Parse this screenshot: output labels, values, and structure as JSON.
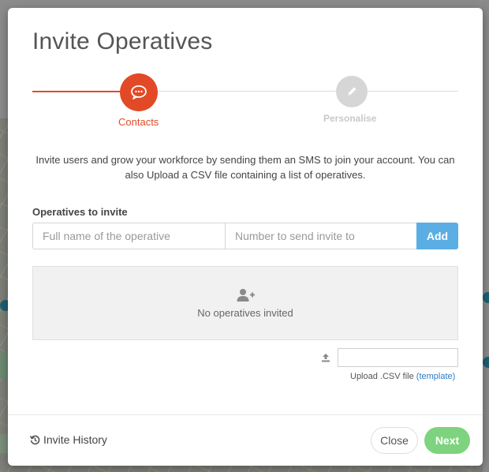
{
  "modal": {
    "title": "Invite Operatives",
    "steps": [
      {
        "label": "Contacts",
        "state": "active"
      },
      {
        "label": "Personalise",
        "state": "inactive"
      }
    ],
    "description": "Invite users and grow your workforce by sending them an SMS to join your account. You can also Upload a CSV file containing a list of operatives.",
    "form": {
      "label": "Operatives to invite",
      "name_placeholder": "Full name of the operative",
      "number_placeholder": "Number to send invite to",
      "add_label": "Add"
    },
    "empty_state": "No operatives invited",
    "upload": {
      "caption": "Upload .CSV file",
      "template_link": "(template)"
    },
    "footer": {
      "history_label": "Invite History",
      "close_label": "Close",
      "next_label": "Next"
    }
  },
  "colors": {
    "accent": "#e24a27",
    "add_button": "#5aaee3",
    "next_button": "#7ed37f",
    "link": "#2a7dc3"
  },
  "icons": {
    "step1": "chat-bubble-icon",
    "step2": "pencil-icon",
    "empty": "add-user-icon",
    "upload": "upload-icon",
    "history": "history-icon"
  }
}
